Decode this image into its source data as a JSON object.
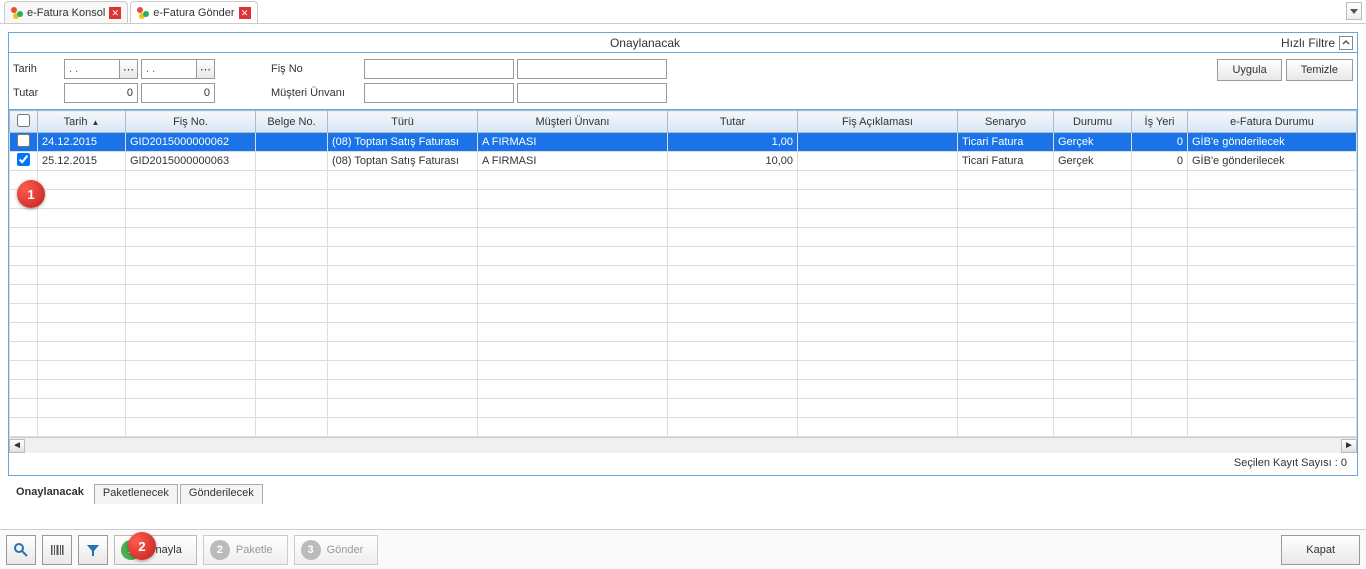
{
  "tabs": [
    {
      "label": "e-Fatura Konsol",
      "closable": true,
      "active": false
    },
    {
      "label": "e-Fatura Gönder",
      "closable": true,
      "active": true
    }
  ],
  "panel": {
    "title": "Onaylanacak",
    "quick_filter_label": "Hızlı Filtre"
  },
  "filters": {
    "tarih_label": "Tarih",
    "tutar_label": "Tutar",
    "fis_no_label": "Fiş No",
    "musteri_label": "Müşteri Ünvanı",
    "date_from_placeholder": ". .",
    "date_to_placeholder": ". .",
    "tutar_from": "0",
    "tutar_to": "0",
    "fis_no_value": "",
    "fis_no_value2": "",
    "musteri_value": "",
    "musteri_value2": "",
    "apply_label": "Uygula",
    "clear_label": "Temizle"
  },
  "grid": {
    "headers": {
      "tarih": "Tarih",
      "fisno": "Fiş No.",
      "belge": "Belge No.",
      "turu": "Türü",
      "musteri": "Müşteri Ünvanı",
      "tutar": "Tutar",
      "acik": "Fiş Açıklaması",
      "sen": "Senaryo",
      "durum": "Durumu",
      "isyeri": "İş Yeri",
      "efat": "e-Fatura Durumu"
    },
    "rows": [
      {
        "checked": false,
        "selected": true,
        "tarih": "24.12.2015",
        "fisno": "GID2015000000062",
        "belge": "",
        "turu": "(08) Toptan Satış Faturası",
        "musteri": "A FIRMASI",
        "tutar": "1,00",
        "acik": "",
        "sen": "Ticari Fatura",
        "durum": "Gerçek",
        "isyeri": "0",
        "efat": "GİB'e gönderilecek"
      },
      {
        "checked": true,
        "selected": false,
        "tarih": "25.12.2015",
        "fisno": "GID2015000000063",
        "belge": "",
        "turu": "(08) Toptan Satış Faturası",
        "musteri": "A FIRMASI",
        "tutar": "10,00",
        "acik": "",
        "sen": "Ticari Fatura",
        "durum": "Gerçek",
        "isyeri": "0",
        "efat": "GİB'e gönderilecek"
      }
    ]
  },
  "footer": {
    "selected_count_label": "Seçilen Kayıt Sayısı : 0"
  },
  "subtabs": [
    {
      "label": "Onaylanacak",
      "active": true
    },
    {
      "label": "Paketlenecek",
      "active": false
    },
    {
      "label": "Gönderilecek",
      "active": false
    }
  ],
  "actions": {
    "step1_label": "Onayla",
    "step2_label": "Paketle",
    "step3_label": "Gönder",
    "close_label": "Kapat",
    "step1_num": "1",
    "step2_num": "2",
    "step3_num": "3"
  },
  "callouts": {
    "c1": "1",
    "c2": "2"
  }
}
